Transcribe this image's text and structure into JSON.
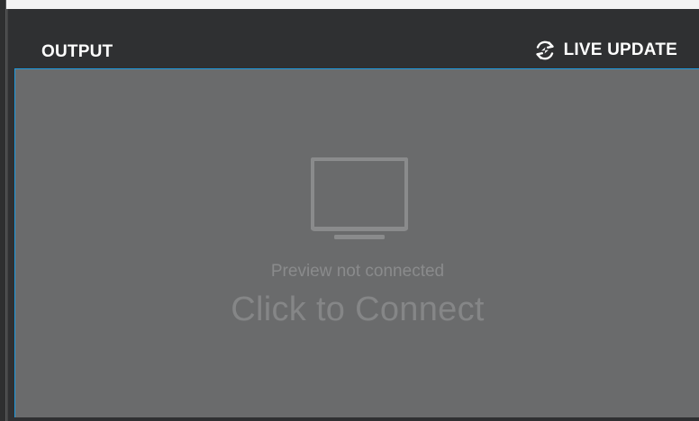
{
  "panel": {
    "title": "OUTPUT",
    "live_update": {
      "label": "LIVE UPDATE",
      "icon": "sync-icon"
    }
  },
  "preview": {
    "icon": "monitor-icon",
    "status": "Preview not connected",
    "action": "Click to Connect"
  },
  "colors": {
    "header_bg": "#2f3032",
    "preview_bg": "#6a6b6c",
    "preview_border": "#1f9be0",
    "header_text": "#ffffff",
    "preview_text": "#858687"
  }
}
